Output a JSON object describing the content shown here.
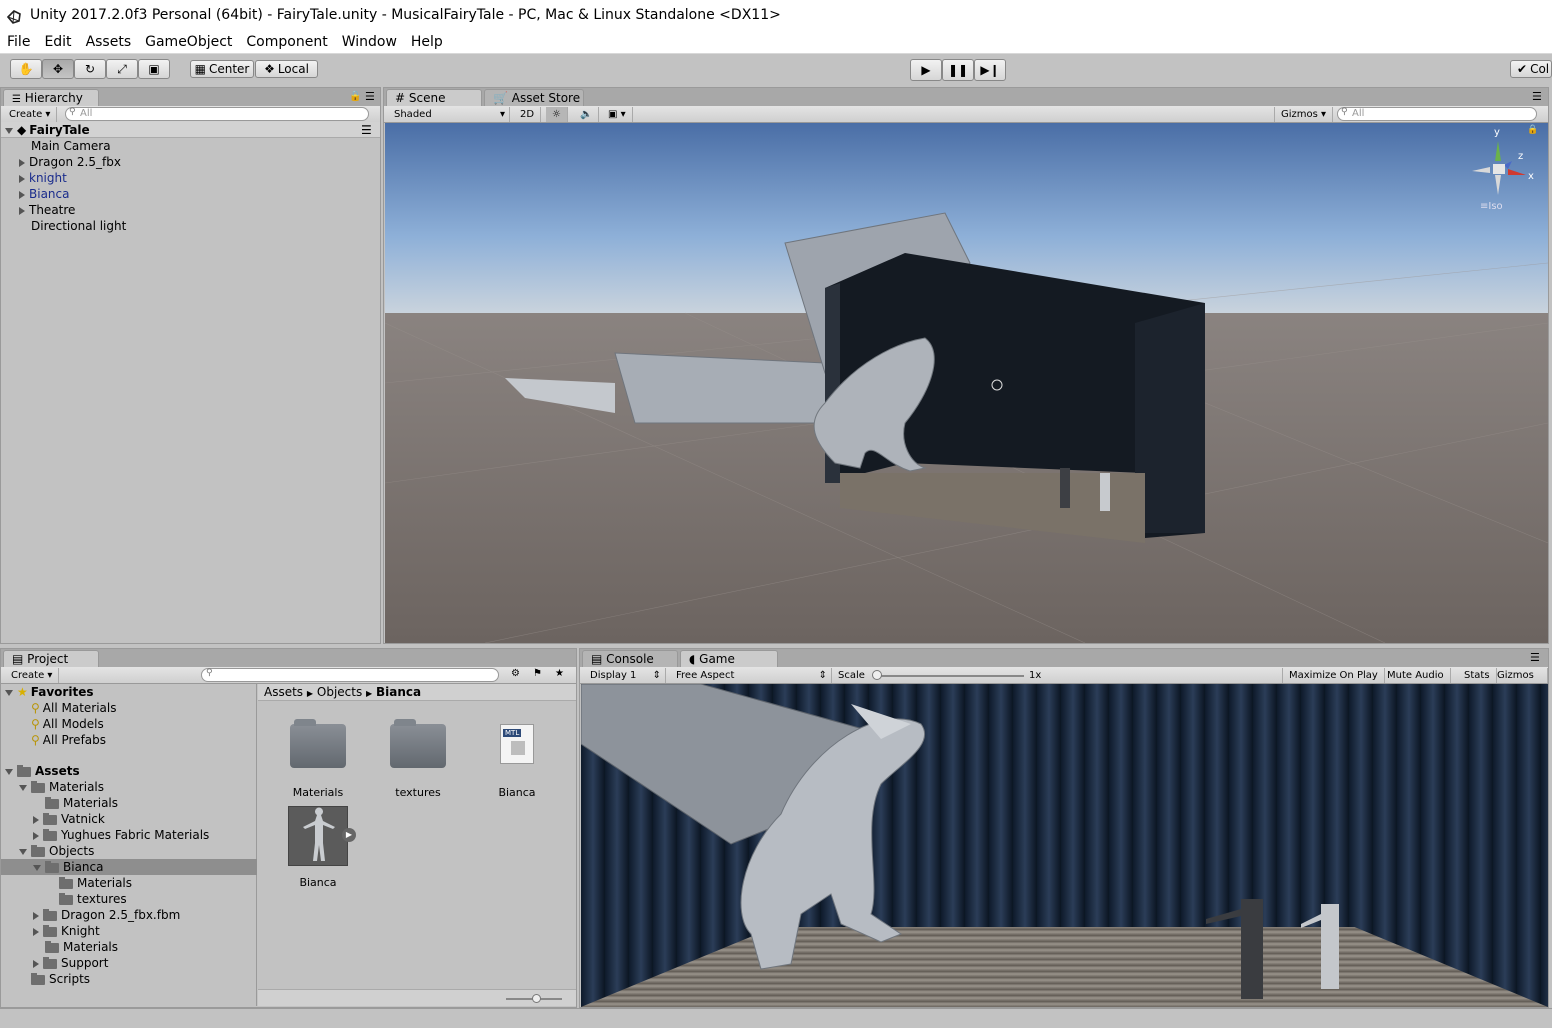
{
  "window": {
    "title": "Unity 2017.2.0f3 Personal (64bit) - FairyTale.unity - MusicalFairyTale - PC, Mac & Linux Standalone <DX11>"
  },
  "menu": [
    "File",
    "Edit",
    "Assets",
    "GameObject",
    "Component",
    "Window",
    "Help"
  ],
  "toolbar": {
    "center_label": "Center",
    "local_label": "Local",
    "collab_label": "Col"
  },
  "hierarchy": {
    "tab": "Hierarchy",
    "create_label": "Create",
    "search_placeholder": "All",
    "scene_name": "FairyTale",
    "items": [
      {
        "label": "Main Camera",
        "expandable": false,
        "prefab": false
      },
      {
        "label": "Dragon 2.5_fbx",
        "expandable": true,
        "prefab": false
      },
      {
        "label": "knight",
        "expandable": true,
        "prefab": true
      },
      {
        "label": "Bianca",
        "expandable": true,
        "prefab": true
      },
      {
        "label": "Theatre",
        "expandable": true,
        "prefab": false
      },
      {
        "label": "Directional light",
        "expandable": false,
        "prefab": false
      }
    ]
  },
  "scene": {
    "tabs": [
      "Scene",
      "Asset Store"
    ],
    "shading": "Shaded",
    "mode_2d": "2D",
    "gizmos_label": "Gizmos",
    "search_placeholder": "All",
    "gizmo_axes": {
      "y": "y",
      "z": "z",
      "x": "x"
    },
    "projection": "Iso"
  },
  "project": {
    "tab": "Project",
    "create_label": "Create",
    "favorites": {
      "label": "Favorites",
      "items": [
        "All Materials",
        "All Models",
        "All Prefabs"
      ]
    },
    "assets_label": "Assets",
    "tree": [
      {
        "label": "Materials",
        "depth": 1,
        "arrow": "down"
      },
      {
        "label": "Materials",
        "depth": 2,
        "arrow": "none"
      },
      {
        "label": "Vatnick",
        "depth": 2,
        "arrow": "right"
      },
      {
        "label": "Yughues Fabric Materials",
        "depth": 2,
        "arrow": "right"
      },
      {
        "label": "Objects",
        "depth": 1,
        "arrow": "down"
      },
      {
        "label": "Bianca",
        "depth": 2,
        "arrow": "down",
        "selected": true
      },
      {
        "label": "Materials",
        "depth": 3,
        "arrow": "none"
      },
      {
        "label": "textures",
        "depth": 3,
        "arrow": "none"
      },
      {
        "label": "Dragon 2.5_fbx.fbm",
        "depth": 2,
        "arrow": "right"
      },
      {
        "label": "Knight",
        "depth": 2,
        "arrow": "right"
      },
      {
        "label": "Materials",
        "depth": 2,
        "arrow": "none"
      },
      {
        "label": "Support",
        "depth": 2,
        "arrow": "right"
      },
      {
        "label": "Scripts",
        "depth": 1,
        "arrow": "none"
      }
    ],
    "breadcrumb": [
      "Assets",
      "Objects",
      "Bianca"
    ],
    "tiles": [
      {
        "label": "Materials",
        "kind": "folder"
      },
      {
        "label": "textures",
        "kind": "folder"
      },
      {
        "label": "Bianca",
        "kind": "mtl"
      },
      {
        "label": "Bianca",
        "kind": "model"
      }
    ],
    "mtl_badge": "MTL"
  },
  "game": {
    "tabs": [
      "Console",
      "Game"
    ],
    "display": "Display 1",
    "aspect": "Free Aspect",
    "scale_label": "Scale",
    "scale_value": "1x",
    "buttons": [
      "Maximize On Play",
      "Mute Audio",
      "Stats",
      "Gizmos"
    ]
  }
}
